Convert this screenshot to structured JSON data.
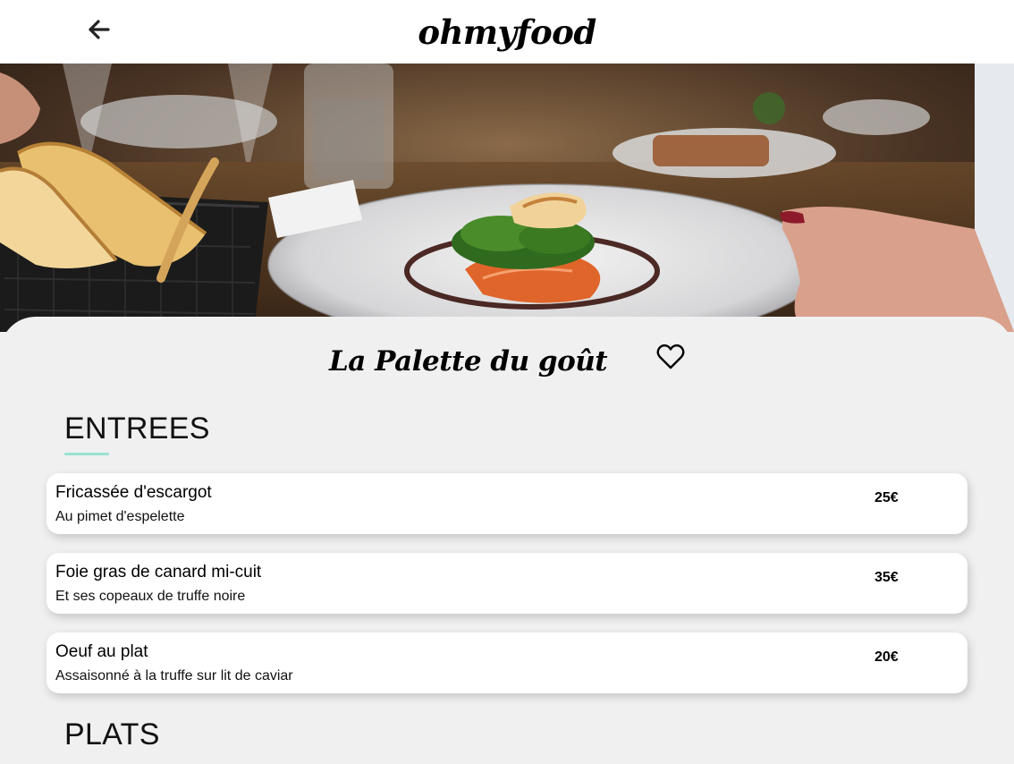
{
  "header": {
    "back_icon": "arrow-left-icon",
    "logo": "ohmyfood"
  },
  "hero": {
    "image": "restaurant-dish-photo"
  },
  "restaurant": {
    "title": "La Palette du goût",
    "favorite_icon": "heart-outline-icon"
  },
  "sections": [
    {
      "title": "ENTREES",
      "accent_color": "#99e2d0",
      "dishes": [
        {
          "name": "Fricassée d'escargot",
          "description": "Au pimet d'espelette",
          "price": "25€"
        },
        {
          "name": "Foie gras de canard mi-cuit",
          "description": "Et ses copeaux de truffe noire",
          "price": "35€"
        },
        {
          "name": "Oeuf au plat",
          "description": "Assaisonné à la truffe sur lit de caviar",
          "price": "20€"
        }
      ]
    },
    {
      "title": "PLATS"
    }
  ]
}
